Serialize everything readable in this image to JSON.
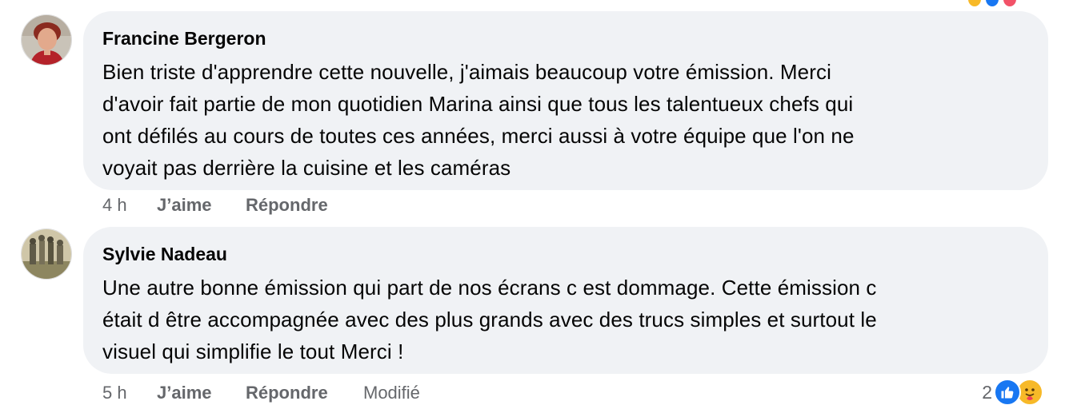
{
  "comments": [
    {
      "author": "Francine Bergeron",
      "lines": [
        "Bien triste d'apprendre cette nouvelle, j'aimais beaucoup votre émission. Merci",
        "d'avoir fait partie de mon quotidien Marina ainsi que tous les talentueux chefs qui",
        "ont défilés au cours de toutes ces années, merci aussi à votre équipe que l'on ne",
        "voyait pas derrière la cuisine et les caméras"
      ],
      "time": "4 h",
      "like_label": "J’aime",
      "reply_label": "Répondre"
    },
    {
      "author": "Sylvie Nadeau",
      "lines": [
        "Une autre bonne émission qui part de nos écrans c est dommage. Cette émission c",
        "était d être accompagnée avec des plus grands avec des trucs simples et surtout le",
        "visuel qui simplifie le tout Merci !"
      ],
      "time": "5 h",
      "like_label": "J’aime",
      "reply_label": "Répondre",
      "edited_label": "Modifié",
      "reaction_count": "2",
      "reaction_icons": [
        "like-icon",
        "care-icon"
      ]
    }
  ],
  "colors": {
    "bubble": "#f0f2f5",
    "meta": "#65676b",
    "like_blue": "#1877f2",
    "care_yellow": "#f7b928"
  }
}
